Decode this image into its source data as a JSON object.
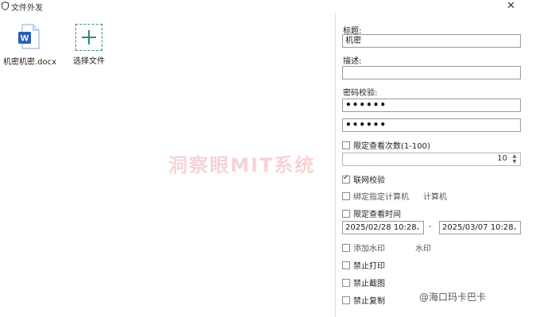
{
  "window": {
    "title": "文件外发",
    "close_glyph": "✕"
  },
  "files": [
    {
      "name": "机密机密.docx",
      "icon": "word-document-icon"
    }
  ],
  "select_file": {
    "label": "选择文件",
    "icon": "plus-icon"
  },
  "watermark_overlay": "洞察眼MIT系统",
  "form": {
    "title_label": "标题:",
    "title_value": "机密",
    "description_label": "描述:",
    "description_value": "",
    "password_label": "密码校验:",
    "password1": "••••••",
    "password2": "••••••",
    "limit_views_label": "限定查看次数(1-100)",
    "limit_views_checked": false,
    "views_value": "10",
    "network_check_label": "联网校验",
    "network_check_checked": true,
    "bind_computer_label": "绑定指定计算机",
    "bind_computer_checked": false,
    "computer_side_label": "计算机",
    "limit_time_label": "限定查看时间",
    "limit_time_checked": false,
    "start_time": "2025/02/28 10:28",
    "end_time": "2025/03/07 10:28",
    "time_separator": "-",
    "add_watermark_label": "添加水印",
    "add_watermark_checked": false,
    "watermark_side_label": "水印",
    "no_print_label": "禁止打印",
    "no_print_checked": false,
    "no_screenshot_label": "禁止截图",
    "no_screenshot_checked": false,
    "no_copy_label": "禁止复制",
    "no_copy_checked": false
  },
  "footer_watermark": "@海口玛卡巴卡"
}
